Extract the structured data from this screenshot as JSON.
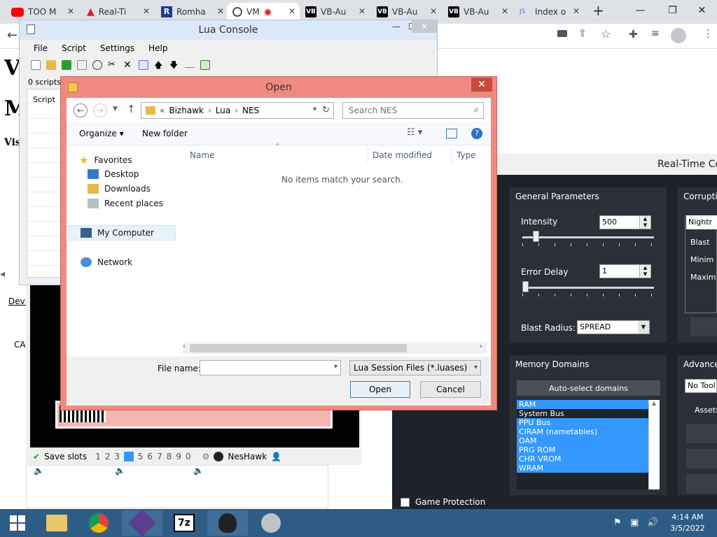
{
  "browser": {
    "tabs": [
      {
        "label": "TOO M",
        "icon": "youtube-icon"
      },
      {
        "label": "Real-Ti",
        "icon": "warning-triangle-icon"
      },
      {
        "label": "Romha",
        "icon": "romhack-icon"
      },
      {
        "label": "VM",
        "icon": "globe-icon",
        "active": true
      },
      {
        "label": "VB-Au",
        "icon": "vb-audio-icon"
      },
      {
        "label": "VB-Au",
        "icon": "vb-audio-icon"
      },
      {
        "label": "VB-Au",
        "icon": "vb-audio-icon"
      },
      {
        "label": "Index o",
        "icon": "js-icon"
      }
    ],
    "new_tab": "+",
    "vb_badge": "VB",
    "js_badge": "JS"
  },
  "website": {
    "letters": [
      "V",
      "M",
      "Vis"
    ],
    "side_labels": [
      "Devi",
      "CA"
    ]
  },
  "lua_console": {
    "title": "Lua Console",
    "menu": [
      "File",
      "Script",
      "Settings",
      "Help"
    ],
    "scripts_count": "0 scripts",
    "column_script": "Script"
  },
  "open_dialog": {
    "title": "Open",
    "breadcrumb": [
      "«",
      "Bizhawk",
      "Lua",
      "NES"
    ],
    "search_placeholder": "Search NES",
    "organize": "Organize ▾",
    "new_folder": "New folder",
    "nav": {
      "favorites": "Favorites",
      "desktop": "Desktop",
      "downloads": "Downloads",
      "recent": "Recent places",
      "computer": "My Computer",
      "network": "Network"
    },
    "columns": [
      "Name",
      "Date modified",
      "Type"
    ],
    "empty_message": "No items match your search.",
    "filename_label": "File name:",
    "filename_value": "",
    "filetype": "Lua Session Files (*.luases)",
    "open_button": "Open",
    "cancel_button": "Cancel"
  },
  "rtc": {
    "title": "Real-Time Co",
    "general": {
      "title": "General Parameters",
      "intensity_label": "Intensity",
      "intensity_value": "500",
      "intensity_fraction": 0.1,
      "error_delay_label": "Error Delay",
      "error_delay_value": "1",
      "error_delay_fraction": 0.0,
      "blast_radius_label": "Blast Radius:",
      "blast_radius_value": "SPREAD"
    },
    "corruption": {
      "title": "Corruptio",
      "engine": "Nightr",
      "labels": [
        "Blast",
        "Minim",
        "Maxim"
      ]
    },
    "memory": {
      "title": "Memory Domains",
      "auto_select": "Auto-select domains",
      "domains": [
        {
          "name": "RAM",
          "selected": true
        },
        {
          "name": "System Bus",
          "selected": false
        },
        {
          "name": "PPU Bus",
          "selected": true
        },
        {
          "name": "CIRAM (nametables)",
          "selected": true
        },
        {
          "name": "OAM",
          "selected": true
        },
        {
          "name": "PRG ROM",
          "selected": true
        },
        {
          "name": "CHR VROM",
          "selected": true
        },
        {
          "name": "WRAM",
          "selected": true
        }
      ]
    },
    "advanced": {
      "title": "Advanced",
      "tool": "No Tool",
      "assets": "Assets"
    },
    "game_protection": "Game Protection"
  },
  "nes": {
    "save_slots_label": "Save slots",
    "slots": [
      "1",
      "2",
      "3",
      "4",
      "5",
      "6",
      "7",
      "8",
      "9",
      "0"
    ],
    "selected_slot": "4",
    "app_name": "NesHawk"
  },
  "taskbar": {
    "time": "4:14 AM",
    "date": "3/5/2022",
    "seven_zip": "7z"
  },
  "colors": {
    "dialog_frame": "#f08a80",
    "rtc_bg": "#1e2329",
    "selection": "#3399ff",
    "taskbar": "#2d5d87"
  }
}
